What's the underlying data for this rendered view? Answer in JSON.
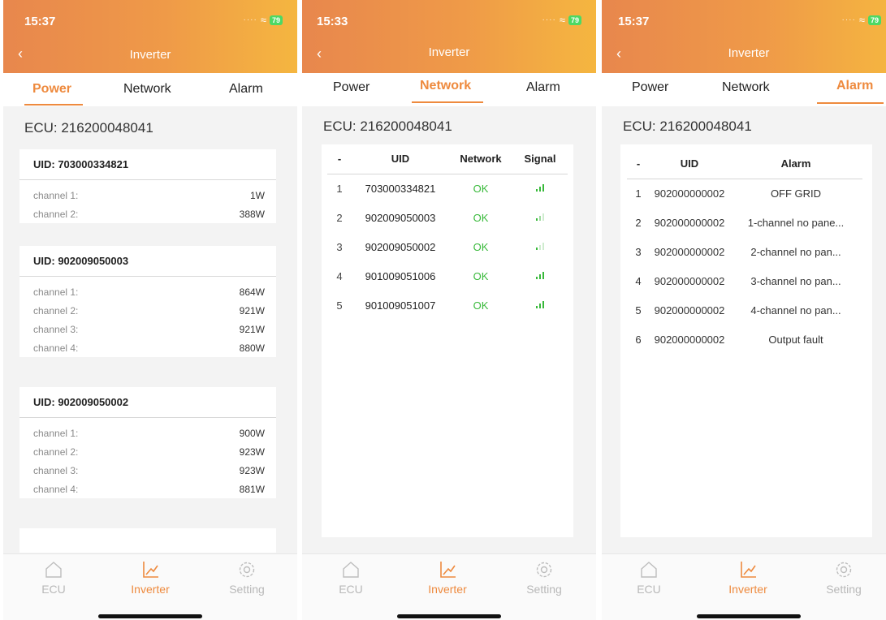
{
  "colors": {
    "accent": "#ee8a3e",
    "ok": "#38b93a",
    "header_start": "#e8874d",
    "header_end": "#f5b640"
  },
  "screens": [
    {
      "time": "15:37",
      "battery": "79",
      "title": "Inverter",
      "tabs": [
        "Power",
        "Network",
        "Alarm"
      ],
      "active_tab": "Power",
      "ecu": "ECU: 216200048041",
      "cards": [
        {
          "uid": "UID: 703000334821",
          "channels": [
            {
              "label": "channel 1:",
              "value": "1W"
            },
            {
              "label": "channel 2:",
              "value": "388W"
            }
          ]
        },
        {
          "uid": "UID: 902009050003",
          "channels": [
            {
              "label": "channel 1:",
              "value": "864W"
            },
            {
              "label": "channel 2:",
              "value": "921W"
            },
            {
              "label": "channel 3:",
              "value": "921W"
            },
            {
              "label": "channel 4:",
              "value": "880W"
            }
          ]
        },
        {
          "uid": "UID: 902009050002",
          "channels": [
            {
              "label": "channel 1:",
              "value": "900W"
            },
            {
              "label": "channel 2:",
              "value": "923W"
            },
            {
              "label": "channel 3:",
              "value": "923W"
            },
            {
              "label": "channel 4:",
              "value": "881W"
            }
          ]
        }
      ],
      "nav": [
        "ECU",
        "Inverter",
        "Setting"
      ]
    },
    {
      "time": "15:33",
      "battery": "79",
      "title": "Inverter",
      "tabs": [
        "Power",
        "Network",
        "Alarm"
      ],
      "active_tab": "Network",
      "ecu": "ECU: 216200048041",
      "table_headers": [
        "-",
        "UID",
        "Network",
        "Signal"
      ],
      "rows": [
        {
          "n": "1",
          "uid": "703000334821",
          "network": "OK",
          "signal": "strong"
        },
        {
          "n": "2",
          "uid": "902009050003",
          "network": "OK",
          "signal": "weak"
        },
        {
          "n": "3",
          "uid": "902009050002",
          "network": "OK",
          "signal": "weak"
        },
        {
          "n": "4",
          "uid": "901009051006",
          "network": "OK",
          "signal": "strong"
        },
        {
          "n": "5",
          "uid": "901009051007",
          "network": "OK",
          "signal": "strong"
        }
      ],
      "nav": [
        "ECU",
        "Inverter",
        "Setting"
      ]
    },
    {
      "time": "15:37",
      "battery": "79",
      "title": "Inverter",
      "tabs": [
        "Power",
        "Network",
        "Alarm"
      ],
      "active_tab": "Alarm",
      "ecu": "ECU: 216200048041",
      "table_headers": [
        "-",
        "UID",
        "Alarm"
      ],
      "rows": [
        {
          "n": "1",
          "uid": "902000000002",
          "alarm": "OFF GRID"
        },
        {
          "n": "2",
          "uid": "902000000002",
          "alarm": "1-channel no pane..."
        },
        {
          "n": "3",
          "uid": "902000000002",
          "alarm": "2-channel no pan..."
        },
        {
          "n": "4",
          "uid": "902000000002",
          "alarm": "3-channel no pan..."
        },
        {
          "n": "5",
          "uid": "902000000002",
          "alarm": "4-channel no pan..."
        },
        {
          "n": "6",
          "uid": "902000000002",
          "alarm": "Output fault"
        }
      ],
      "nav": [
        "ECU",
        "Inverter",
        "Setting"
      ]
    }
  ]
}
